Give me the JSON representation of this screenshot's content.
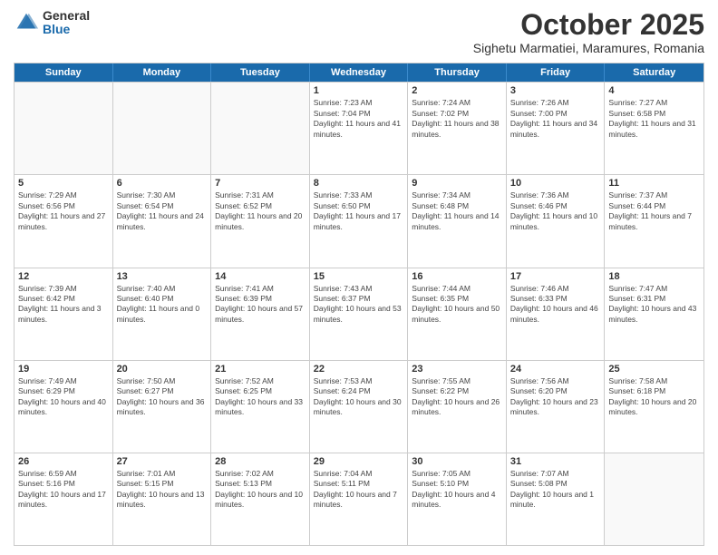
{
  "header": {
    "logo_general": "General",
    "logo_blue": "Blue",
    "month": "October 2025",
    "location": "Sighetu Marmatiei, Maramures, Romania"
  },
  "days_of_week": [
    "Sunday",
    "Monday",
    "Tuesday",
    "Wednesday",
    "Thursday",
    "Friday",
    "Saturday"
  ],
  "rows": [
    [
      {
        "day": "",
        "empty": true
      },
      {
        "day": "",
        "empty": true
      },
      {
        "day": "",
        "empty": true
      },
      {
        "day": "1",
        "sunrise": "7:23 AM",
        "sunset": "7:04 PM",
        "daylight": "11 hours and 41 minutes."
      },
      {
        "day": "2",
        "sunrise": "7:24 AM",
        "sunset": "7:02 PM",
        "daylight": "11 hours and 38 minutes."
      },
      {
        "day": "3",
        "sunrise": "7:26 AM",
        "sunset": "7:00 PM",
        "daylight": "11 hours and 34 minutes."
      },
      {
        "day": "4",
        "sunrise": "7:27 AM",
        "sunset": "6:58 PM",
        "daylight": "11 hours and 31 minutes."
      }
    ],
    [
      {
        "day": "5",
        "sunrise": "7:29 AM",
        "sunset": "6:56 PM",
        "daylight": "11 hours and 27 minutes."
      },
      {
        "day": "6",
        "sunrise": "7:30 AM",
        "sunset": "6:54 PM",
        "daylight": "11 hours and 24 minutes."
      },
      {
        "day": "7",
        "sunrise": "7:31 AM",
        "sunset": "6:52 PM",
        "daylight": "11 hours and 20 minutes."
      },
      {
        "day": "8",
        "sunrise": "7:33 AM",
        "sunset": "6:50 PM",
        "daylight": "11 hours and 17 minutes."
      },
      {
        "day": "9",
        "sunrise": "7:34 AM",
        "sunset": "6:48 PM",
        "daylight": "11 hours and 14 minutes."
      },
      {
        "day": "10",
        "sunrise": "7:36 AM",
        "sunset": "6:46 PM",
        "daylight": "11 hours and 10 minutes."
      },
      {
        "day": "11",
        "sunrise": "7:37 AM",
        "sunset": "6:44 PM",
        "daylight": "11 hours and 7 minutes."
      }
    ],
    [
      {
        "day": "12",
        "sunrise": "7:39 AM",
        "sunset": "6:42 PM",
        "daylight": "11 hours and 3 minutes."
      },
      {
        "day": "13",
        "sunrise": "7:40 AM",
        "sunset": "6:40 PM",
        "daylight": "11 hours and 0 minutes."
      },
      {
        "day": "14",
        "sunrise": "7:41 AM",
        "sunset": "6:39 PM",
        "daylight": "10 hours and 57 minutes."
      },
      {
        "day": "15",
        "sunrise": "7:43 AM",
        "sunset": "6:37 PM",
        "daylight": "10 hours and 53 minutes."
      },
      {
        "day": "16",
        "sunrise": "7:44 AM",
        "sunset": "6:35 PM",
        "daylight": "10 hours and 50 minutes."
      },
      {
        "day": "17",
        "sunrise": "7:46 AM",
        "sunset": "6:33 PM",
        "daylight": "10 hours and 46 minutes."
      },
      {
        "day": "18",
        "sunrise": "7:47 AM",
        "sunset": "6:31 PM",
        "daylight": "10 hours and 43 minutes."
      }
    ],
    [
      {
        "day": "19",
        "sunrise": "7:49 AM",
        "sunset": "6:29 PM",
        "daylight": "10 hours and 40 minutes."
      },
      {
        "day": "20",
        "sunrise": "7:50 AM",
        "sunset": "6:27 PM",
        "daylight": "10 hours and 36 minutes."
      },
      {
        "day": "21",
        "sunrise": "7:52 AM",
        "sunset": "6:25 PM",
        "daylight": "10 hours and 33 minutes."
      },
      {
        "day": "22",
        "sunrise": "7:53 AM",
        "sunset": "6:24 PM",
        "daylight": "10 hours and 30 minutes."
      },
      {
        "day": "23",
        "sunrise": "7:55 AM",
        "sunset": "6:22 PM",
        "daylight": "10 hours and 26 minutes."
      },
      {
        "day": "24",
        "sunrise": "7:56 AM",
        "sunset": "6:20 PM",
        "daylight": "10 hours and 23 minutes."
      },
      {
        "day": "25",
        "sunrise": "7:58 AM",
        "sunset": "6:18 PM",
        "daylight": "10 hours and 20 minutes."
      }
    ],
    [
      {
        "day": "26",
        "sunrise": "6:59 AM",
        "sunset": "5:16 PM",
        "daylight": "10 hours and 17 minutes."
      },
      {
        "day": "27",
        "sunrise": "7:01 AM",
        "sunset": "5:15 PM",
        "daylight": "10 hours and 13 minutes."
      },
      {
        "day": "28",
        "sunrise": "7:02 AM",
        "sunset": "5:13 PM",
        "daylight": "10 hours and 10 minutes."
      },
      {
        "day": "29",
        "sunrise": "7:04 AM",
        "sunset": "5:11 PM",
        "daylight": "10 hours and 7 minutes."
      },
      {
        "day": "30",
        "sunrise": "7:05 AM",
        "sunset": "5:10 PM",
        "daylight": "10 hours and 4 minutes."
      },
      {
        "day": "31",
        "sunrise": "7:07 AM",
        "sunset": "5:08 PM",
        "daylight": "10 hours and 1 minute."
      },
      {
        "day": "",
        "empty": true
      }
    ]
  ]
}
